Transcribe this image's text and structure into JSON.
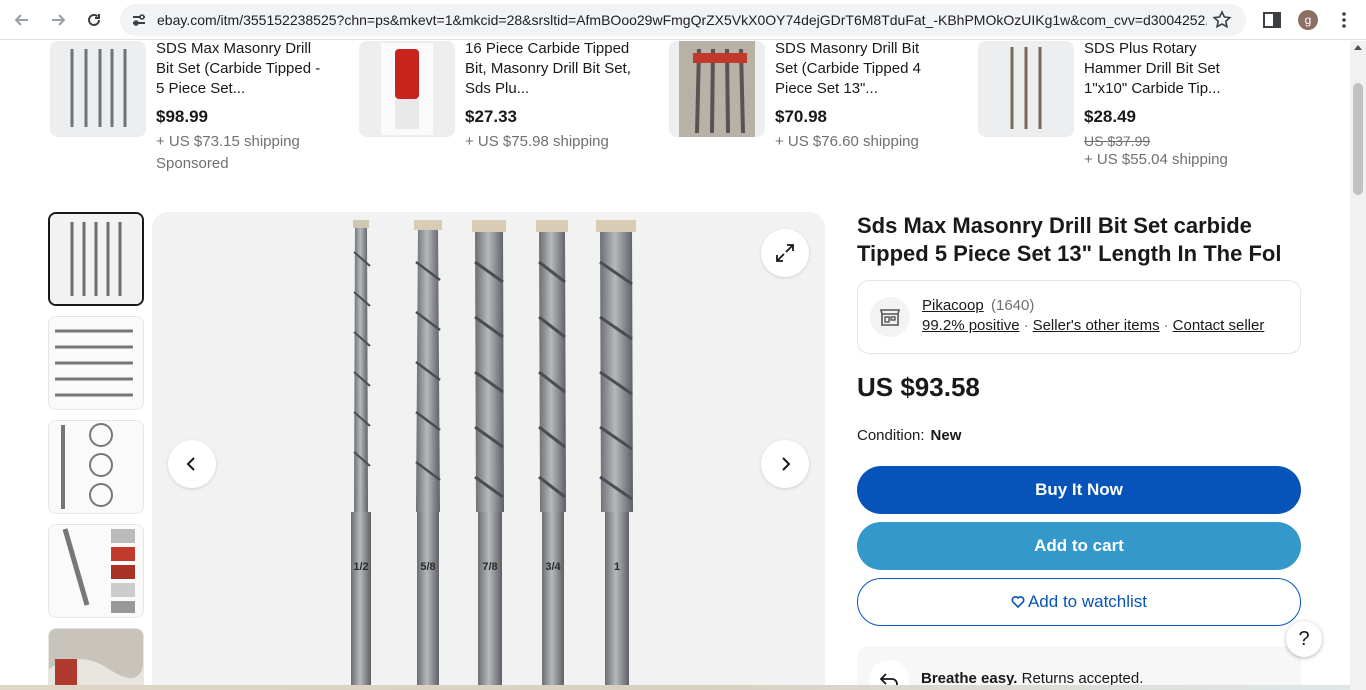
{
  "browser": {
    "url": "ebay.com/itm/355152238525?chn=ps&mkevt=1&mkcid=28&srsltid=AfmBOoo29wFmgQrZX5VkX0OY74dejGDrT6M8TduFat_-KBhPMOkOzUIKg1w&com_cvv=d3004252...",
    "avatar_letter": "g"
  },
  "related_items": [
    {
      "title": "SDS Max Masonry Drill Bit Set (Carbide Tipped - 5 Piece Set...",
      "price": "$98.99",
      "was": "",
      "shipping": "+ US $73.15 shipping",
      "sponsored": "Sponsored"
    },
    {
      "title": "16 Piece Carbide Tipped Bit, Masonry Drill Bit Set, Sds Plu...",
      "price": "$27.33",
      "was": "",
      "shipping": "+ US $75.98 shipping",
      "sponsored": ""
    },
    {
      "title": "SDS Masonry Drill Bit Set (Carbide Tipped 4 Piece Set 13\"...",
      "price": "$70.98",
      "was": "",
      "shipping": "+ US $76.60 shipping",
      "sponsored": ""
    },
    {
      "title": "SDS Plus Rotary Hammer Drill Bit Set 1\"x10\" Carbide Tip...",
      "price": "$28.49",
      "was": "US $37.99",
      "shipping": "+ US $55.04 shipping",
      "sponsored": ""
    }
  ],
  "product": {
    "title": "Sds Max Masonry Drill Bit Set carbide Tipped 5 Piece Set 13\" Length In The Fol",
    "price": "US $93.58",
    "condition_label": "Condition:",
    "condition_value": "New"
  },
  "bit_labels": [
    "1/2",
    "5/8",
    "7/8",
    "3/4",
    "1"
  ],
  "seller": {
    "name": "Pikacoop",
    "count": "(1640)",
    "positive": "99.2% positive",
    "other_items": "Seller's other items",
    "contact": "Contact seller"
  },
  "buttons": {
    "buy_now": "Buy It Now",
    "add_to_cart": "Add to cart",
    "watchlist": "Add to watchlist"
  },
  "returns": {
    "bold": "Breathe easy.",
    "text": "Returns accepted."
  },
  "help_label": "?"
}
